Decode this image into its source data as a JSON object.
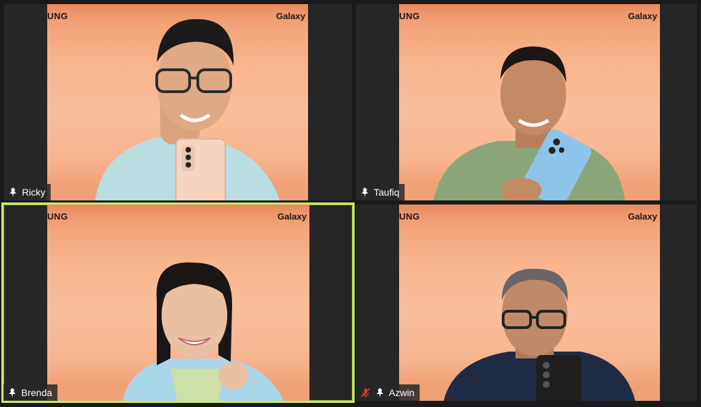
{
  "participants": [
    {
      "name": "Ricky",
      "brand_left": "UNG",
      "brand_right": "Galaxy",
      "muted": false,
      "active_speaker": false
    },
    {
      "name": "Taufiq",
      "brand_left": "UNG",
      "brand_right": "Galaxy",
      "muted": false,
      "active_speaker": false
    },
    {
      "name": "Brenda",
      "brand_left": "UNG",
      "brand_right": "Galaxy",
      "muted": false,
      "active_speaker": true
    },
    {
      "name": "Azwin",
      "brand_left": "UNG",
      "brand_right": "Galaxy",
      "muted": true,
      "active_speaker": false
    }
  ],
  "colors": {
    "active_speaker_border": "#c7ea6a",
    "tile_background": "#262626",
    "backdrop_orange": "#f8bf9c",
    "mute_red": "#e0352b"
  },
  "icons": {
    "pin": "pin-icon",
    "muted": "mic-muted-icon"
  }
}
